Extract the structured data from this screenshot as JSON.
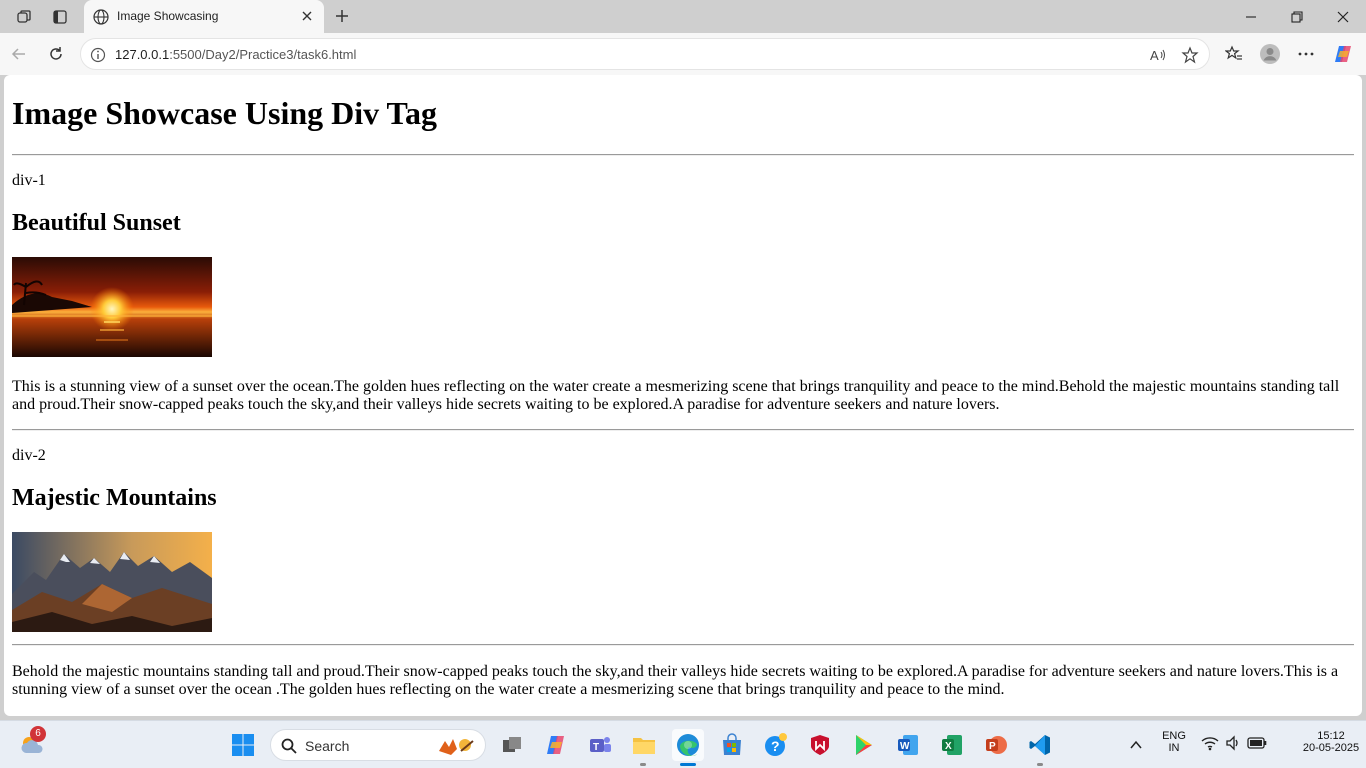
{
  "browser": {
    "tab_title": "Image Showcasing",
    "url_host": "127.0.0.1",
    "url_path": ":5500/Day2/Practice3/task6.html"
  },
  "page": {
    "title": "Image Showcase Using Div Tag",
    "sections": [
      {
        "label": "div-1",
        "heading": "Beautiful Sunset",
        "text": "This is a stunning view of a sunset over the ocean.The golden hues reflecting on the water create a mesmerizing scene that brings tranquility and peace to the mind.Behold the majestic mountains standing tall and proud.Their snow-capped peaks touch the sky,and their valleys hide secrets waiting to be explored.A paradise for adventure seekers and nature lovers."
      },
      {
        "label": "div-2",
        "heading": "Majestic Mountains",
        "text": "Behold the majestic mountains standing tall and proud.Their snow-capped peaks touch the sky,and their valleys hide secrets waiting to be explored.A paradise for adventure seekers and nature lovers.This is a stunning view of a sunset over the ocean .The golden hues reflecting on the water create a mesmerizing scene that brings tranquility and peace to the mind."
      }
    ]
  },
  "taskbar": {
    "search_placeholder": "Search",
    "weather_badge": "6",
    "lang_1": "ENG",
    "lang_2": "IN",
    "time": "15:12",
    "date": "20-05-2025"
  },
  "colors": {
    "accent": "#0078d4",
    "chrome_bg": "#cfcfcf",
    "toolbar_bg": "#f7f7f7"
  },
  "icons": [
    "workspaces-icon",
    "tab-actions-icon",
    "globe-icon",
    "close-icon",
    "plus-icon",
    "minimize-icon",
    "restore-icon",
    "window-close-icon",
    "back-icon",
    "refresh-icon",
    "info-icon",
    "read-aloud-icon",
    "favorite-star-icon",
    "favorites-icon",
    "profile-icon",
    "more-icon",
    "copilot-icon",
    "windows-start-icon",
    "search-icon",
    "task-view-icon",
    "file-explorer-icon",
    "edge-icon",
    "store-icon",
    "word-icon",
    "excel-icon",
    "powerpoint-icon",
    "vscode-icon",
    "wifi-icon",
    "volume-icon",
    "battery-icon"
  ]
}
